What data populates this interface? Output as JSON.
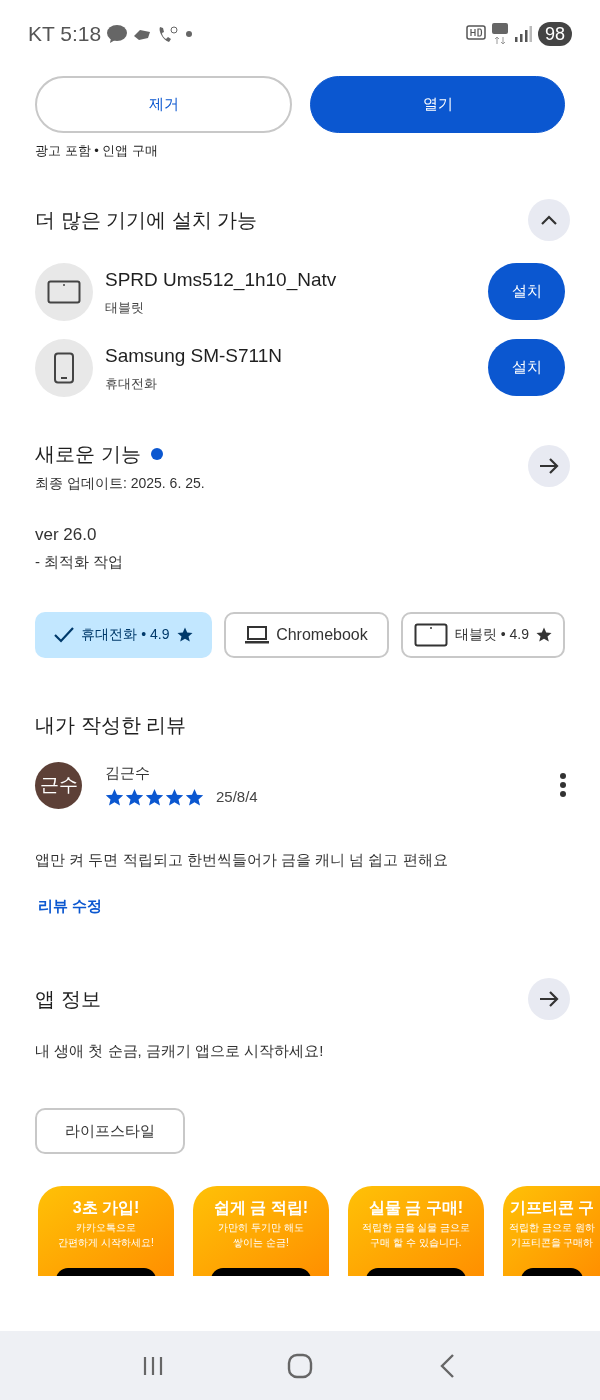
{
  "status_bar": {
    "carrier_time": "KT 5:18",
    "battery": "98"
  },
  "actions": [
    {
      "label": "제거",
      "kind": "outline"
    },
    {
      "label": "열기",
      "kind": "filled"
    }
  ],
  "notice": "광고 포함 • 인앱 구매",
  "devices_section": {
    "title": "더 많은 기기에 설치 가능",
    "expanded": true,
    "devices": [
      {
        "name": "SPRD Ums512_1h10_Natv",
        "type": "태블릿",
        "kind": "tablet",
        "button": "설치"
      },
      {
        "name": "Samsung SM-S711N",
        "type": "휴대전화",
        "kind": "phone",
        "button": "설치"
      }
    ]
  },
  "whats_new": {
    "title": "새로운 기능",
    "updated": "최종 업데이트: 2025. 6. 25.",
    "version": "ver 26.0",
    "notes": "- 최적화 작업"
  },
  "device_chips": [
    {
      "label": "휴대전화 • 4.9",
      "kind": "phone",
      "star": true,
      "selected": true
    },
    {
      "label": "Chromebook",
      "kind": "laptop",
      "star": false,
      "selected": false
    },
    {
      "label": "태블릿 • 4.9",
      "kind": "tablet",
      "star": true,
      "selected": false
    }
  ],
  "my_review": {
    "title": "내가 작성한 리뷰",
    "avatar": "근수",
    "author": "김근수",
    "stars": 5,
    "date": "25/8/4",
    "text": "앱만 켜 두면 적립되고 한번씩들어가 금을 캐니 넘 쉽고 편해요",
    "edit_link": "리뷰 수정"
  },
  "app_info": {
    "title": "앱 정보",
    "description": "내 생애 첫 순금, 금캐기 앱으로 시작하세요!",
    "tag": "라이프스타일"
  },
  "screenshots": [
    {
      "headline": "3초 가입!",
      "lines": [
        "카카오톡으로",
        "간편하게 시작하세요!"
      ]
    },
    {
      "headline": "쉽게 금 적립!",
      "lines": [
        "가만히 두기만 해도",
        "쌓이는 순금!"
      ]
    },
    {
      "headline": "실물 금 구매!",
      "lines": [
        "적립한 금을 실물 금으로",
        "구매 할 수 있습니다."
      ]
    },
    {
      "headline": "기프티콘 구",
      "lines": [
        "적립한 금으로 원하",
        "기프티콘을 구매하"
      ]
    }
  ]
}
